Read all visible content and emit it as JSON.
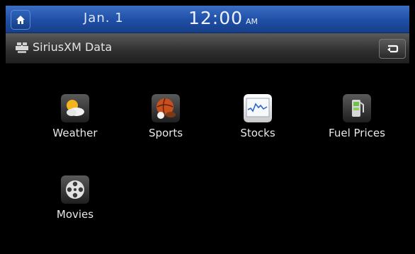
{
  "status_bar": {
    "date": "Jan. 1",
    "time": "12:00",
    "ampm": "AM"
  },
  "title_bar": {
    "title": "SiriusXM Data",
    "icon": "satellite-icon",
    "back_icon": "back-arrow-icon"
  },
  "apps": [
    {
      "label": "Weather",
      "icon": "weather-icon"
    },
    {
      "label": "Sports",
      "icon": "sports-icon"
    },
    {
      "label": "Stocks",
      "icon": "stocks-icon"
    },
    {
      "label": "Fuel Prices",
      "icon": "fuel-prices-icon"
    },
    {
      "label": "Movies",
      "icon": "movies-icon"
    }
  ],
  "colors": {
    "status_bar": "#1e4ea5",
    "title_bar": "#2e2e2e",
    "background": "#000000"
  }
}
